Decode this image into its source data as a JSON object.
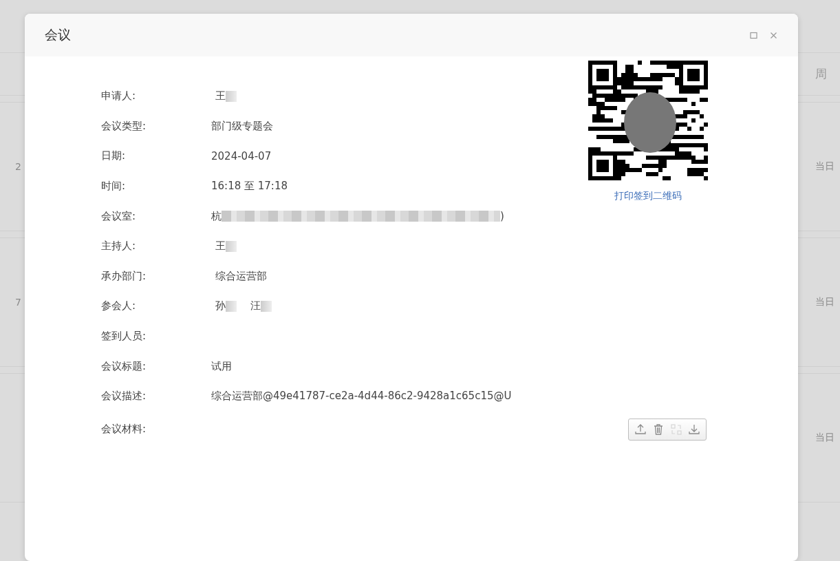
{
  "background_table": {
    "header": "周",
    "rows": [
      {
        "column_1": "2",
        "column_2": "当日"
      },
      {
        "column_1": "7",
        "column_2": "当日"
      },
      {
        "column_1": "",
        "column_2": "当日"
      }
    ]
  },
  "dialog": {
    "title": "会议",
    "fields": [
      {
        "label": "申请人:",
        "value": "王",
        "redacted": true,
        "indent": true
      },
      {
        "label": "会议类型:",
        "value": "部门级专题会",
        "redacted": false,
        "indent": false
      },
      {
        "label": "日期:",
        "value": "2024-04-07",
        "redacted": false,
        "indent": false
      },
      {
        "label": "时间:",
        "value": "16:18 至 17:18",
        "redacted": false,
        "indent": false
      },
      {
        "label": "会议室:",
        "value": "杭",
        "redacted": true,
        "indent": false,
        "value_end": ")",
        "long_redaction": true
      },
      {
        "label": "主持人:",
        "value": "王",
        "redacted": true,
        "indent": true
      },
      {
        "label": "承办部门:",
        "value": "综合运营部",
        "redacted": false,
        "indent": true
      },
      {
        "label": "参会人:",
        "value": "孙",
        "redacted": true,
        "indent": true,
        "extra": "汪"
      },
      {
        "label": "签到人员:"
      },
      {
        "label": "会议标题:",
        "value": "试用",
        "redacted": false,
        "indent": false
      },
      {
        "label": "会议描述:",
        "value": "综合运营部@49e41787-ce2a-4d44-86c2-9428a1c65c15@U",
        "redacted": false,
        "indent": false
      }
    ],
    "materials": {
      "label": "会议材料:",
      "tools": [
        {
          "kind": "upload",
          "disabled": false
        },
        {
          "kind": "delete",
          "disabled": false
        },
        {
          "kind": "preview",
          "disabled": true
        },
        {
          "kind": "download",
          "disabled": false
        }
      ]
    },
    "qr_link": "打印签到二维码"
  }
}
